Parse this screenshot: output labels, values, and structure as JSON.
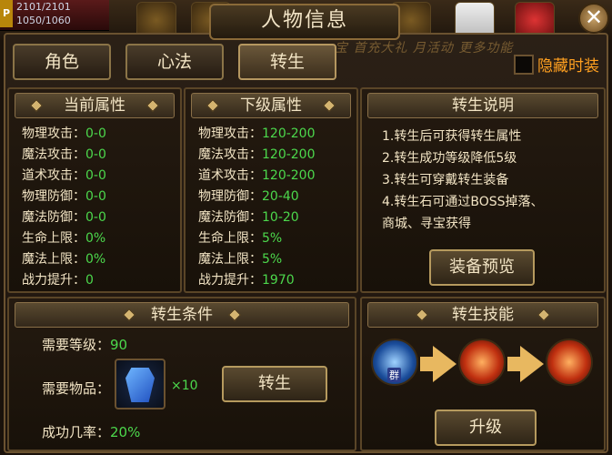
{
  "hud": {
    "hp": "2101/2101",
    "mp": "1050/1060",
    "badge": "P"
  },
  "window": {
    "title": "人物信息",
    "close_glyph": "✕",
    "banner": "宝  首充大礼  月活动  更多功能"
  },
  "tabs": [
    {
      "label": "角色"
    },
    {
      "label": "心法"
    },
    {
      "label": "转生",
      "active": true
    }
  ],
  "hide_fashion": {
    "label": "隐藏时装",
    "checked": false
  },
  "current_attrs": {
    "title": "当前属性",
    "rows": [
      {
        "name": "物理攻击：",
        "value": "0-0"
      },
      {
        "name": "魔法攻击：",
        "value": "0-0"
      },
      {
        "name": "道术攻击：",
        "value": "0-0"
      },
      {
        "name": "物理防御：",
        "value": "0-0"
      },
      {
        "name": "魔法防御：",
        "value": "0-0"
      },
      {
        "name": "生命上限：",
        "value": "0%"
      },
      {
        "name": "魔法上限：",
        "value": "0%"
      },
      {
        "name": "战力提升：",
        "value": "0"
      }
    ]
  },
  "next_attrs": {
    "title": "下级属性",
    "rows": [
      {
        "name": "物理攻击：",
        "value": "120-200"
      },
      {
        "name": "魔法攻击：",
        "value": "120-200"
      },
      {
        "name": "道术攻击：",
        "value": "120-200"
      },
      {
        "name": "物理防御：",
        "value": "20-40"
      },
      {
        "name": "魔法防御：",
        "value": "10-20"
      },
      {
        "name": "生命上限：",
        "value": "5%"
      },
      {
        "name": "魔法上限：",
        "value": "5%"
      },
      {
        "name": "战力提升：",
        "value": "1970"
      }
    ]
  },
  "rebirth_desc": {
    "title": "转生说明",
    "lines": [
      "1.转生后可获得转生属性",
      "2.转生成功等级降低5级",
      "3.转生可穿戴转生装备",
      "4.转生石可通过BOSS掉落、",
      "商城、寻宝获得"
    ],
    "preview_button": "装备预览"
  },
  "conditions": {
    "title": "转生条件",
    "level_label": "需要等级：",
    "level_value": "90",
    "item_label": "需要物品：",
    "item_icon": "rebirth-stone-icon",
    "item_count": "×10",
    "rate_label": "成功几率：",
    "rate_value": "20%",
    "rebirth_button": "转生"
  },
  "skills": {
    "title": "转生技能",
    "badge": "群",
    "upgrade_button": "升级"
  },
  "colors": {
    "value_green": "#4cd84c",
    "accent_orange": "#ffa020",
    "cream_text": "#f2e4c4"
  }
}
